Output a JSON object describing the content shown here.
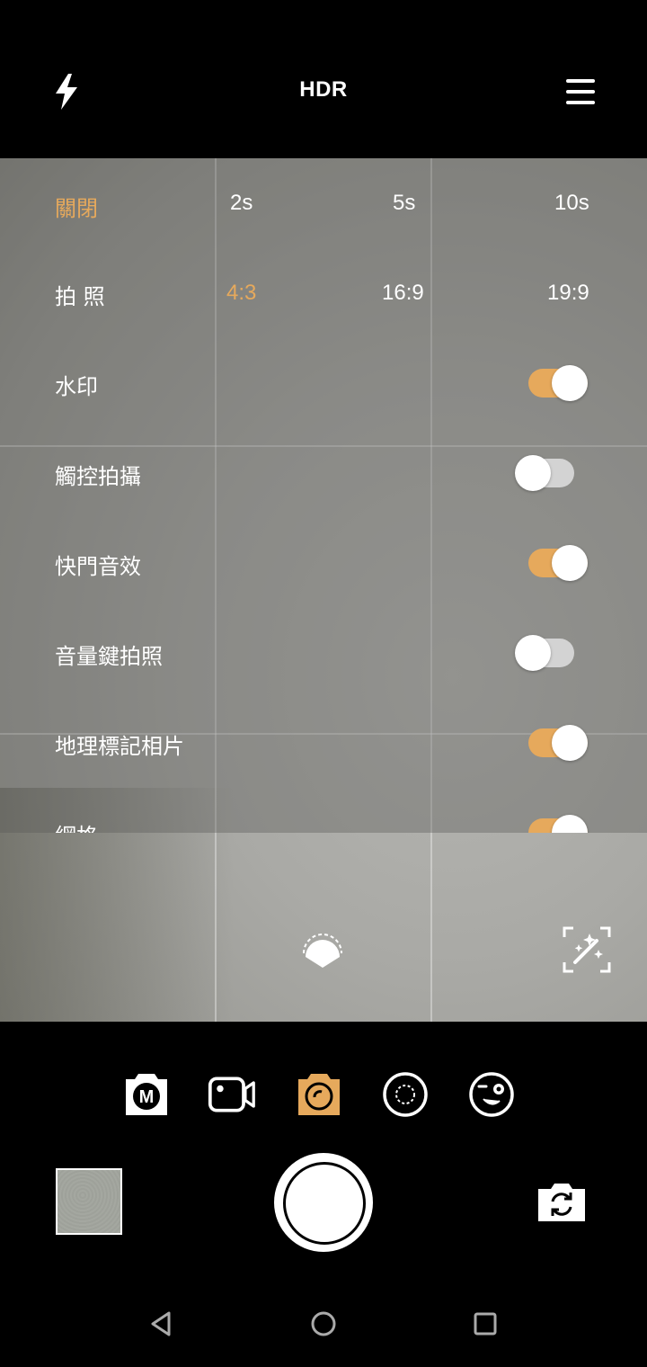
{
  "topbar": {
    "flash_icon": "flash-icon",
    "hdr_label": "HDR",
    "menu_icon": "hamburger-menu-icon"
  },
  "settings": {
    "timer": {
      "options": [
        "關閉",
        "2s",
        "5s",
        "10s"
      ],
      "selected": "關閉"
    },
    "ratio": {
      "label": "拍 照",
      "options": [
        "4:3",
        "16:9",
        "19:9"
      ],
      "selected": "4:3"
    },
    "toggles": [
      {
        "label": "水印",
        "on": true
      },
      {
        "label": "觸控拍攝",
        "on": false
      },
      {
        "label": "快門音效",
        "on": true
      },
      {
        "label": "音量鍵拍照",
        "on": false
      },
      {
        "label": "地理標記相片",
        "on": true
      },
      {
        "label": "網格",
        "on": true
      }
    ]
  },
  "viewfinder": {
    "beauty_icon": "beauty-face-icon",
    "ai_scene_icon": "ai-scene-magic-icon"
  },
  "modes": [
    {
      "icon": "manual-mode-icon",
      "label": "M"
    },
    {
      "icon": "video-mode-icon"
    },
    {
      "icon": "photo-mode-icon",
      "active": true
    },
    {
      "icon": "panorama-mode-icon"
    },
    {
      "icon": "selfie-mode-icon"
    }
  ],
  "colors": {
    "accent": "#e6a95c"
  },
  "nav": [
    "back-icon",
    "home-icon",
    "recents-icon"
  ]
}
